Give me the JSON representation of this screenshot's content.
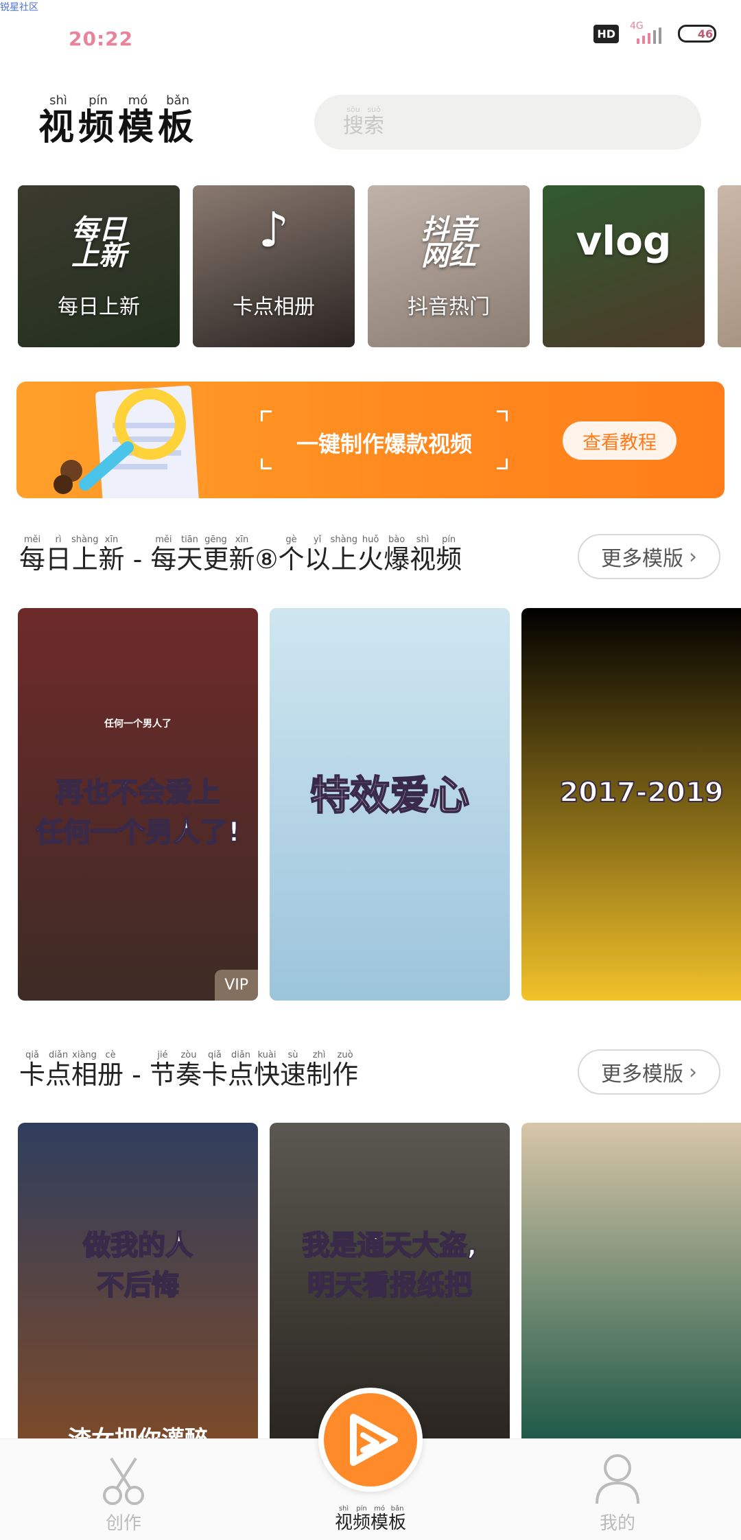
{
  "watermark": "锐星社区",
  "status_bar": {
    "time": "20:22",
    "hd": "HD",
    "network": "4G",
    "battery": "46"
  },
  "header": {
    "title_chars": [
      {
        "char": "视",
        "pinyin": "shì"
      },
      {
        "char": "频",
        "pinyin": "pín"
      },
      {
        "char": "模",
        "pinyin": "mó"
      },
      {
        "char": "板",
        "pinyin": "bǎn"
      }
    ],
    "search": {
      "placeholder_chars": [
        {
          "char": "搜",
          "pinyin": "sōu"
        },
        {
          "char": "索",
          "pinyin": "suǒ"
        }
      ]
    }
  },
  "categories": [
    {
      "label": "每日上新",
      "emblem": "每日\n上新",
      "bg": [
        "#3b3a2e",
        "#23301f"
      ]
    },
    {
      "label": "卡点相册",
      "emblem": "",
      "bg": [
        "#8a7a70",
        "#2a2422"
      ]
    },
    {
      "label": "抖音热门",
      "emblem": "抖音\n网红",
      "bg": [
        "#bfb2a8",
        "#8b7c72"
      ]
    },
    {
      "label": "",
      "emblem": "vlog",
      "bg": [
        "#2f5a2e",
        "#4e3a2a"
      ]
    },
    {
      "label": "",
      "emblem": "",
      "bg": [
        "#c9b8a8",
        "#a08a78"
      ]
    }
  ],
  "banner": {
    "slogan": "一键制作爆款视频",
    "button": "查看教程",
    "accent": "#ff8a1f"
  },
  "sections": [
    {
      "title_chars": [
        {
          "char": "每",
          "pinyin": "měi"
        },
        {
          "char": "日",
          "pinyin": "rì"
        },
        {
          "char": "上",
          "pinyin": "shàng"
        },
        {
          "char": "新",
          "pinyin": "xīn"
        },
        {
          "char": " - ",
          "pinyin": ""
        },
        {
          "char": "每",
          "pinyin": "měi"
        },
        {
          "char": "天",
          "pinyin": "tiān"
        },
        {
          "char": "更",
          "pinyin": "gēng"
        },
        {
          "char": "新",
          "pinyin": "xīn"
        },
        {
          "char": "⑧",
          "pinyin": ""
        },
        {
          "char": "个",
          "pinyin": "gè"
        },
        {
          "char": "以",
          "pinyin": "yǐ"
        },
        {
          "char": "上",
          "pinyin": "shàng"
        },
        {
          "char": "火",
          "pinyin": "huǒ"
        },
        {
          "char": "爆",
          "pinyin": "bào"
        },
        {
          "char": "视",
          "pinyin": "shì"
        },
        {
          "char": "频",
          "pinyin": "pín"
        }
      ],
      "more": "更多模版",
      "cards": [
        {
          "caption": "再也不会爱上\n任何一个男人了!",
          "subtitle": "任何一个男人了",
          "vip": "VIP",
          "bg": [
            "#6e2a2a",
            "#3d2b25"
          ]
        },
        {
          "caption": "特效爱心",
          "subtitle": "",
          "vip": "",
          "bg": [
            "#cfe6f0",
            "#9cc4dc"
          ]
        },
        {
          "caption": "2017-2019",
          "subtitle": "",
          "vip": "",
          "bg": [
            "#000000",
            "#f2c22a"
          ]
        }
      ]
    },
    {
      "title_chars": [
        {
          "char": "卡",
          "pinyin": "qiǎ"
        },
        {
          "char": "点",
          "pinyin": "diǎn"
        },
        {
          "char": "相",
          "pinyin": "xiàng"
        },
        {
          "char": "册",
          "pinyin": "cè"
        },
        {
          "char": " - ",
          "pinyin": ""
        },
        {
          "char": "节",
          "pinyin": "jié"
        },
        {
          "char": "奏",
          "pinyin": "zòu"
        },
        {
          "char": "卡",
          "pinyin": "qiǎ"
        },
        {
          "char": "点",
          "pinyin": "diǎn"
        },
        {
          "char": "快",
          "pinyin": "kuài"
        },
        {
          "char": "速",
          "pinyin": "sù"
        },
        {
          "char": "制",
          "pinyin": "zhì"
        },
        {
          "char": "作",
          "pinyin": "zuò"
        }
      ],
      "more": "更多模版",
      "cards": [
        {
          "caption": "做我的人\n不后悔",
          "subtitle": "渣女把你灌醉",
          "vip": "",
          "bg": [
            "#2f3e5e",
            "#7a4a2a"
          ]
        },
        {
          "caption": "我是通天大盗,\n明天看报纸把",
          "subtitle": "",
          "vip": "",
          "bg": [
            "#5a5850",
            "#2a2520"
          ]
        },
        {
          "caption": "",
          "subtitle": "",
          "vip": "",
          "bg": [
            "#d8c6a8",
            "#1f5a48"
          ]
        }
      ]
    }
  ],
  "bottom_nav": {
    "create": "创作",
    "templates_chars": [
      {
        "char": "视",
        "pinyin": "shì"
      },
      {
        "char": "频",
        "pinyin": "pín"
      },
      {
        "char": "模",
        "pinyin": "mó"
      },
      {
        "char": "板",
        "pinyin": "bǎn"
      }
    ],
    "mine": "我的"
  }
}
